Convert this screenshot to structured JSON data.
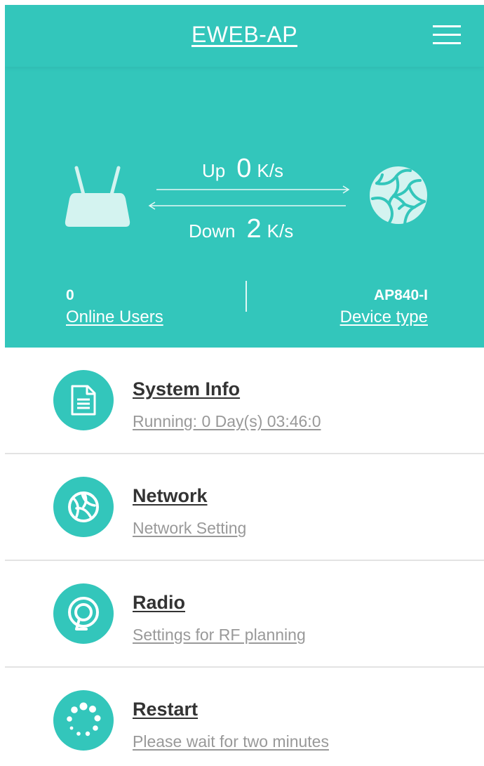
{
  "header": {
    "title": "EWEB-AP",
    "menu_icon": "hamburger-icon"
  },
  "traffic": {
    "up_label": "Up",
    "up_value": "0",
    "up_unit": "K/s",
    "down_label": "Down",
    "down_value": "2",
    "down_unit": "K/s",
    "left_icon": "router-icon",
    "right_icon": "globe-icon"
  },
  "stats": {
    "online_users_value": "0",
    "online_users_label": "Online Users",
    "device_type_value": "AP840-I",
    "device_type_label": "Device type"
  },
  "menu": [
    {
      "icon": "document-icon",
      "title": "System Info",
      "subtitle": "Running:  0 Day(s) 03:46:0"
    },
    {
      "icon": "network-globe-icon",
      "title": "Network",
      "subtitle": "Network Setting"
    },
    {
      "icon": "radio-signal-icon",
      "title": "Radio",
      "subtitle": "Settings for RF planning"
    },
    {
      "icon": "restart-spinner-icon",
      "title": "Restart",
      "subtitle": "Please wait for two minutes"
    }
  ],
  "colors": {
    "accent": "#33c6bb",
    "text_dark": "#333333",
    "text_muted": "#999999"
  }
}
